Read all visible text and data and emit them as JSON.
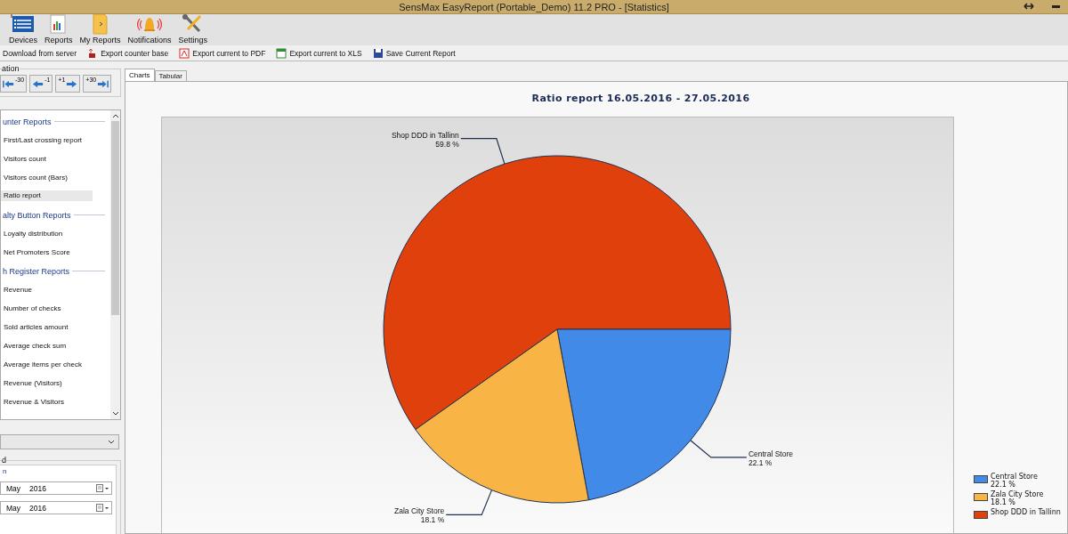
{
  "window": {
    "title": "SensMax EasyReport (Portable_Demo) 11.2 PRO - [Statistics]"
  },
  "toolbar": [
    {
      "label": "Devices",
      "kind": "devices"
    },
    {
      "label": "Reports",
      "kind": "reports"
    },
    {
      "label": "My Reports",
      "kind": "folder"
    },
    {
      "label": "Notifications",
      "kind": "bell"
    },
    {
      "label": "Settings",
      "kind": "tools"
    }
  ],
  "commands": [
    {
      "label": "Download from server",
      "kind": "none"
    },
    {
      "label": "Export counter base",
      "kind": "export"
    },
    {
      "label": "Export current to PDF",
      "kind": "pdf"
    },
    {
      "label": "Export current to XLS",
      "kind": "xls"
    },
    {
      "label": "Save Current Report",
      "kind": "save"
    }
  ],
  "navigation": {
    "title": "ation",
    "buttons": [
      {
        "label": "-30",
        "kind": "first"
      },
      {
        "label": "-1",
        "kind": "prev"
      },
      {
        "label": "+1",
        "kind": "next"
      },
      {
        "label": "+30",
        "kind": "last"
      }
    ]
  },
  "reports": [
    {
      "title": "unter Reports",
      "items": [
        {
          "label": "First/Last crossing report",
          "selected": false
        },
        {
          "label": "Visitors count",
          "selected": false
        },
        {
          "label": "Visitors count (Bars)",
          "selected": false
        },
        {
          "label": "Ratio report",
          "selected": true
        }
      ]
    },
    {
      "title": "alty Button Reports",
      "items": [
        {
          "label": "Loyalty distribution",
          "selected": false
        },
        {
          "label": "Net Promoters Score",
          "selected": false
        }
      ]
    },
    {
      "title": "h Register Reports",
      "items": [
        {
          "label": "Revenue",
          "selected": false
        },
        {
          "label": "Number of checks",
          "selected": false
        },
        {
          "label": "Sold articles amount",
          "selected": false
        },
        {
          "label": "Average check sum",
          "selected": false
        },
        {
          "label": "Average items per check",
          "selected": false
        },
        {
          "label": "Revenue (Visitors)",
          "selected": false
        },
        {
          "label": "Revenue & Visitors",
          "selected": false
        }
      ]
    }
  ],
  "period": {
    "title": "d",
    "subtitle": "n",
    "dates": [
      {
        "month": "May",
        "year": "2016"
      },
      {
        "month": "May",
        "year": "2016"
      }
    ]
  },
  "tabs": [
    {
      "label": "Charts",
      "selected": true
    },
    {
      "label": "Tabular",
      "selected": false
    }
  ],
  "chart": {
    "title": "Ratio report 16.05.2016 - 27.05.2016",
    "chart_data": {
      "type": "pie",
      "categories": [
        "Shop DDD in Tallinn",
        "Central Store",
        "Zala City Store"
      ],
      "values": [
        59.8,
        22.1,
        18.1
      ]
    },
    "slices": [
      {
        "percent": "59.8 %",
        "color": "#e0410c"
      },
      {
        "percent": "22.1 %",
        "color": "#428ae8"
      },
      {
        "percent": "18.1 %",
        "color": "#f8b545"
      }
    ],
    "legend": [
      {
        "name": "Central Store",
        "percent": "22.1 %",
        "color": "#428ae8"
      },
      {
        "name": "Zala City Store",
        "percent": "18.1 %",
        "color": "#f8b545"
      },
      {
        "name": "Shop DDD in Tallinn",
        "color": "#e0410c"
      }
    ]
  }
}
